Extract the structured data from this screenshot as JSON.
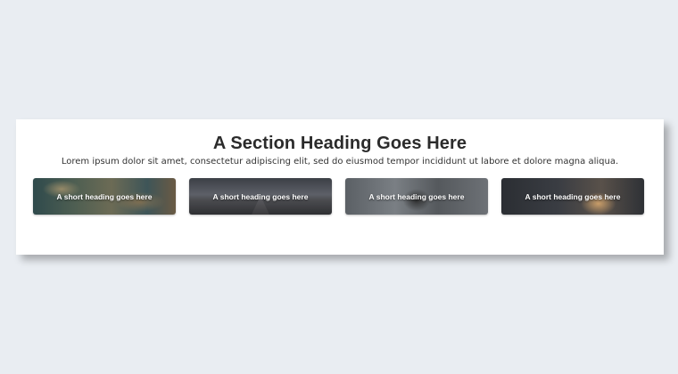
{
  "section": {
    "heading": "A Section Heading Goes Here",
    "subtext": "Lorem ipsum dolor sit amet, consectetur adipiscing elit, sed do eiusmod tempor incididunt ut labore et dolore magna aliqua."
  },
  "cards": [
    {
      "label": "A short heading goes here"
    },
    {
      "label": "A short heading goes here"
    },
    {
      "label": "A short heading goes here"
    },
    {
      "label": "A short heading goes here"
    }
  ]
}
